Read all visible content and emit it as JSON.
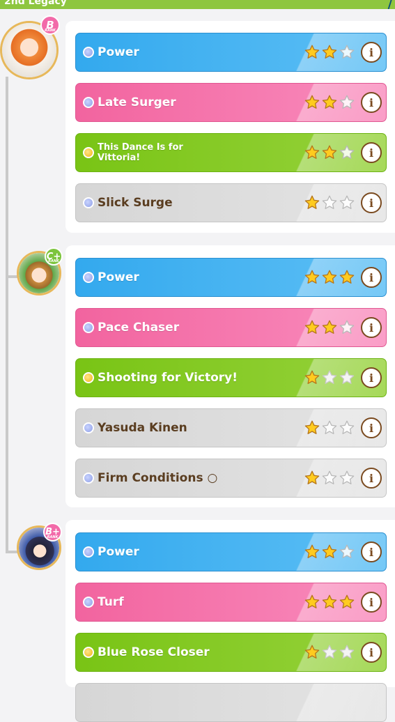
{
  "header": {
    "title": "2nd Legacy"
  },
  "colors": {
    "blue": "#33a9ee",
    "pink": "#f2649f",
    "green": "#79c415",
    "gray": "#d6d6d6"
  },
  "parents": [
    {
      "rank": "B",
      "rank_sub": "RANK",
      "factors": [
        {
          "name": "Power",
          "kind": "blue",
          "dot": "blue",
          "stars": 2
        },
        {
          "name": "Late Surger",
          "kind": "pink",
          "dot": "blue",
          "stars": 2
        },
        {
          "name": "This Dance Is for Vittoria!",
          "kind": "green",
          "dot": "gold",
          "stars": 2
        },
        {
          "name": "Slick Surge",
          "kind": "gray",
          "dot": "blue",
          "stars": 1
        }
      ]
    },
    {
      "rank": "C+",
      "rank_sub": "RANK",
      "factors": [
        {
          "name": "Power",
          "kind": "blue",
          "dot": "blue",
          "stars": 3
        },
        {
          "name": "Pace Chaser",
          "kind": "pink",
          "dot": "blue",
          "stars": 2
        },
        {
          "name": "Shooting for Victory!",
          "kind": "green",
          "dot": "gold",
          "stars": 1
        },
        {
          "name": "Yasuda Kinen",
          "kind": "gray",
          "dot": "blue",
          "stars": 1
        },
        {
          "name": "Firm Conditions ○",
          "kind": "gray",
          "dot": "blue",
          "stars": 1
        }
      ]
    },
    {
      "rank": "B+",
      "rank_sub": "RANK",
      "factors": [
        {
          "name": "Power",
          "kind": "blue",
          "dot": "blue",
          "stars": 2
        },
        {
          "name": "Turf",
          "kind": "pink",
          "dot": "blue",
          "stars": 3
        },
        {
          "name": "Blue Rose Closer",
          "kind": "green",
          "dot": "gold",
          "stars": 1
        }
      ]
    }
  ]
}
